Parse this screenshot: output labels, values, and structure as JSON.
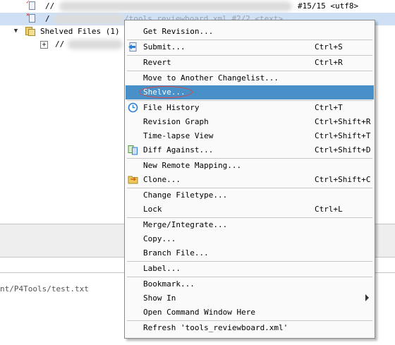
{
  "tree": {
    "row1": {
      "path_prefix": "//",
      "revision_info": "#15/15 <utf8>"
    },
    "row2": {
      "path_prefix": "/",
      "path_tail": "/tools_reviewboard.xml #2/2 <text>"
    },
    "shelved": {
      "label": "Shelved Files (1)"
    },
    "shelved_child": {
      "path_prefix": "//"
    }
  },
  "bottom_panel": {
    "path_text": "nt/P4Tools/test.txt"
  },
  "context_menu": {
    "items": [
      {
        "label": "Get Revision...",
        "shortcut": ""
      },
      {
        "label": "Submit...",
        "shortcut": "Ctrl+S"
      },
      {
        "label": "Revert",
        "shortcut": "Ctrl+R"
      },
      {
        "label": "Move to Another Changelist...",
        "shortcut": ""
      },
      {
        "label": "Shelve...",
        "shortcut": ""
      },
      {
        "label": "File History",
        "shortcut": "Ctrl+T"
      },
      {
        "label": "Revision Graph",
        "shortcut": "Ctrl+Shift+R"
      },
      {
        "label": "Time-lapse View",
        "shortcut": "Ctrl+Shift+T"
      },
      {
        "label": "Diff Against...",
        "shortcut": "Ctrl+Shift+D"
      },
      {
        "label": "New Remote Mapping...",
        "shortcut": ""
      },
      {
        "label": "Clone...",
        "shortcut": "Ctrl+Shift+C"
      },
      {
        "label": "Change Filetype...",
        "shortcut": ""
      },
      {
        "label": "Lock",
        "shortcut": "Ctrl+L"
      },
      {
        "label": "Merge/Integrate...",
        "shortcut": ""
      },
      {
        "label": "Copy...",
        "shortcut": ""
      },
      {
        "label": "Branch File...",
        "shortcut": ""
      },
      {
        "label": "Label...",
        "shortcut": ""
      },
      {
        "label": "Bookmark...",
        "shortcut": ""
      },
      {
        "label": "Show In",
        "shortcut": ""
      },
      {
        "label": "Open Command Window Here",
        "shortcut": ""
      },
      {
        "label": "Refresh 'tools_reviewboard.xml'",
        "shortcut": ""
      }
    ],
    "highlighted_item": "Shelve...",
    "colors": {
      "highlight": "#4a90c8",
      "annotation_ring": "#d34a4a"
    },
    "icons": {
      "submit": "submit-arrow-icon",
      "file_history": "clock-icon",
      "diff_against": "diff-icon",
      "clone": "clone-folder-icon",
      "show_in": "chevron-right-icon"
    }
  }
}
